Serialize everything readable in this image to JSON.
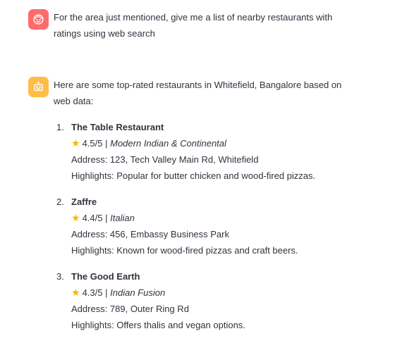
{
  "user_message": {
    "avatar_icon": "user-face-icon",
    "text": "For the area just mentioned, give me a list of nearby restaurants with ratings using web search"
  },
  "assistant_message": {
    "avatar_icon": "robot-icon",
    "intro": "Here are some top-rated restaurants in Whitefield, Bangalore based on web data:",
    "restaurants": [
      {
        "number": "1.",
        "name": "The Table Restaurant",
        "rating": "4.5/5",
        "separator": "|",
        "cuisine": "Modern Indian & Continental",
        "address": "Address: 123, Tech Valley Main Rd, Whitefield",
        "highlights": "Highlights: Popular for butter chicken and wood-fired pizzas."
      },
      {
        "number": "2.",
        "name": "Zaffre",
        "rating": "4.4/5",
        "separator": "|",
        "cuisine": "Italian",
        "address": "Address: 456, Embassy Business Park",
        "highlights": "Highlights: Known for wood-fired pizzas and craft beers."
      },
      {
        "number": "3.",
        "name": "The Good Earth",
        "rating": "4.3/5",
        "separator": "|",
        "cuisine": "Indian Fusion",
        "address": "Address: 789, Outer Ring Rd",
        "highlights": "Highlights: Offers thalis and vegan options."
      }
    ]
  },
  "colors": {
    "text": "#31333f",
    "user_avatar": "#ff6b6b",
    "assistant_avatar": "#ffbd45",
    "star": "#f5b800"
  }
}
